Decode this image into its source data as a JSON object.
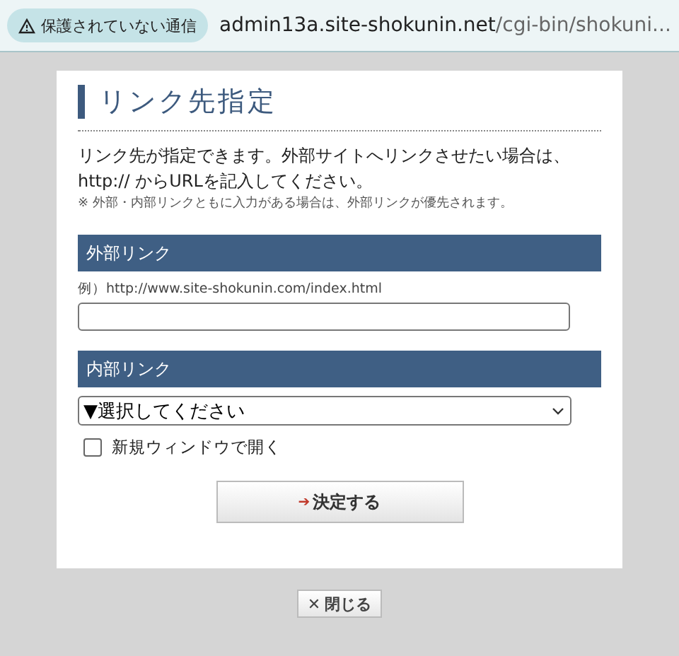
{
  "address_bar": {
    "security_label": "保護されていない通信",
    "url_host": "admin13a.site-shokunin.net",
    "url_path": "/cgi-bin/shokuni..."
  },
  "dialog": {
    "title": "リンク先指定",
    "description": "リンク先が指定できます。外部サイトへリンクさせたい場合は、http:// からURLを記入してください。",
    "note": "※ 外部・内部リンクともに入力がある場合は、外部リンクが優先されます。",
    "external": {
      "heading": "外部リンク",
      "example": "例）http://www.site-shokunin.com/index.html"
    },
    "internal": {
      "heading": "内部リンク",
      "select_value": "▼選択してください"
    },
    "new_window": {
      "label": "新規ウィンドウで開く",
      "checked": false
    },
    "submit": {
      "arrow": "➔",
      "label": "決定する"
    }
  },
  "close_button": {
    "icon": "✕",
    "label": "閉じる"
  }
}
